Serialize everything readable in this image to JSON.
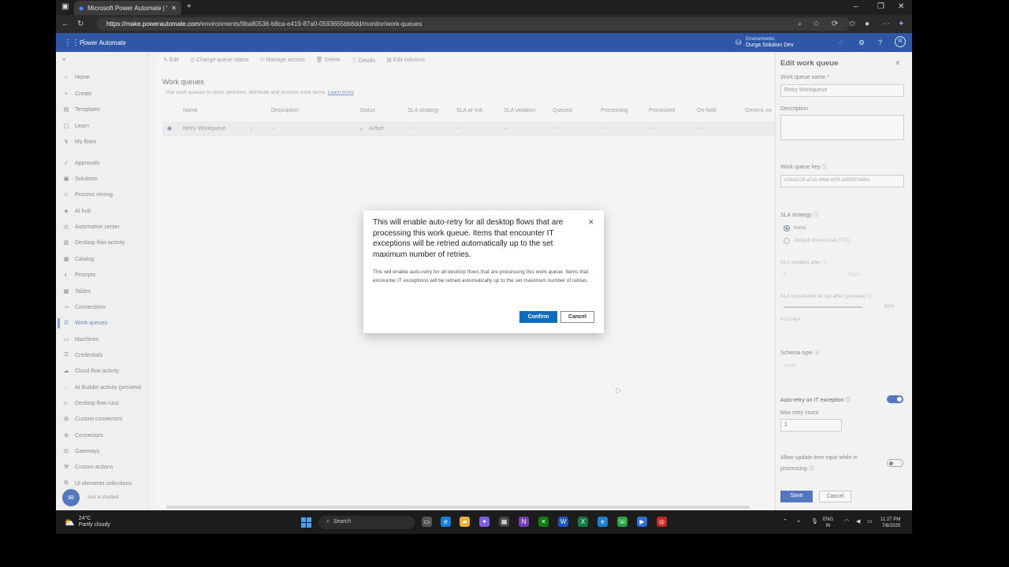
{
  "browser": {
    "tab_title": "Microsoft Power Automate | Wor",
    "url_host": "https://make.powerautomate.com",
    "url_path": "/environments/9ba80536-b8ca-e419-87a0-0593655bb8dd/monitor/work-queues"
  },
  "app_header": {
    "brand": "Power Automate",
    "environment_label": "Environments",
    "environment_name": "Durga Solution Dev",
    "avatar_initials": "R"
  },
  "sidebar": {
    "items": [
      {
        "label": "Home",
        "icon": "home-icon"
      },
      {
        "label": "Create",
        "icon": "plus-icon"
      },
      {
        "label": "Templates",
        "icon": "template-icon"
      },
      {
        "label": "Learn",
        "icon": "book-icon"
      },
      {
        "label": "My flows",
        "icon": "flow-icon"
      },
      {
        "label": "Approvals",
        "icon": "approval-icon"
      },
      {
        "label": "Solutions",
        "icon": "solution-icon"
      },
      {
        "label": "Process mining",
        "icon": "mining-icon"
      },
      {
        "label": "AI hub",
        "icon": "ai-icon"
      },
      {
        "label": "Automation center",
        "icon": "center-icon"
      },
      {
        "label": "Desktop flow activity",
        "icon": "activity-icon"
      },
      {
        "label": "Catalog",
        "icon": "catalog-icon"
      },
      {
        "label": "Prompts",
        "icon": "prompt-icon"
      },
      {
        "label": "Tables",
        "icon": "table-icon"
      },
      {
        "label": "Connections",
        "icon": "connection-icon"
      },
      {
        "label": "Work queues",
        "icon": "queue-icon"
      },
      {
        "label": "Machines",
        "icon": "machine-icon"
      },
      {
        "label": "Credentials",
        "icon": "credential-icon"
      },
      {
        "label": "Cloud flow activity",
        "icon": "cloud-icon"
      },
      {
        "label": "AI Builder activity (preview)",
        "icon": "builder-icon"
      },
      {
        "label": "Desktop flow runs",
        "icon": "runs-icon"
      },
      {
        "label": "Custom connectors",
        "icon": "connector-icon"
      },
      {
        "label": "Connectors",
        "icon": "plug-icon"
      },
      {
        "label": "Gateways",
        "icon": "gateway-icon"
      },
      {
        "label": "Custom actions",
        "icon": "action-icon"
      },
      {
        "label": "UI elements collections",
        "icon": "collection-icon"
      }
    ],
    "selected": "Work queues",
    "chatbot_label": "Ask a chatbot"
  },
  "commands": [
    "Edit",
    "Change queue status",
    "Manage access",
    "Delete",
    "Details",
    "Edit columns"
  ],
  "page": {
    "title": "Work queues",
    "subtitle": "Use work queues to store, prioritize, distribute and process work items.",
    "learn_more": "Learn more"
  },
  "table": {
    "columns": [
      "Name",
      "Description",
      "Status",
      "SLA strategy",
      "SLA at risk",
      "SLA violation",
      "Queued",
      "Processing",
      "Processed",
      "On hold",
      "Generic ex"
    ],
    "row": {
      "name": "Retry Workqueue",
      "description": "--",
      "status": "Active",
      "sla_strategy": "--",
      "sla_at_risk": "--",
      "sla_violation": "--",
      "queued": "--",
      "processing": "--",
      "processed": "--",
      "on_hold": "--"
    }
  },
  "edit_panel": {
    "title": "Edit work queue",
    "name_label": "Work queue name *",
    "name_value": "Retry Workqueue",
    "description_label": "Description",
    "key_label": "Work queue key",
    "key_value": "e28c8139-a7c8-49ab-b00f-dd8f297a6fac",
    "sla_label": "SLA strategy",
    "sla_none": "None",
    "sla_ttl": "Default time-to-live (TTL)",
    "sla_violated_label": "SLA violated after",
    "sla_violated_value": "0",
    "sla_violated_unit": "days",
    "sla_risk_label": "SLA considered at risk after (preview)",
    "sla_risk_percent": "80%",
    "sla_risk_days": "0.0 Days",
    "schema_label": "Schema type",
    "schema_value": "None",
    "auto_retry_label": "Auto-retry on IT exception",
    "max_retry_label": "Max retry count",
    "max_retry_value": "1",
    "allow_update_label": "Allow update item input while in processing",
    "save": "Save",
    "cancel": "Cancel"
  },
  "dialog": {
    "title": "This will enable auto-retry for all desktop flows that are processing this work queue. Items that encounter IT exceptions will be retried automatically up to the set maximum number of retries.",
    "body": "This will enable auto-retry for all desktop flows that are processing this work queue. Items that encounter IT exceptions will be retried automatically up to the set maximum number of retries.",
    "confirm": "Confirm",
    "cancel": "Cancel"
  },
  "taskbar": {
    "temperature": "24°C",
    "weather": "Partly cloudy",
    "search_placeholder": "Search",
    "lang_line1": "ENG",
    "lang_line2": "IN",
    "time": "11:27 PM",
    "date": "7/8/2025"
  },
  "colors": {
    "brand_header": "#2f57a7",
    "primary_button": "#0f6cbd",
    "toggle_on": "#5577c0"
  }
}
